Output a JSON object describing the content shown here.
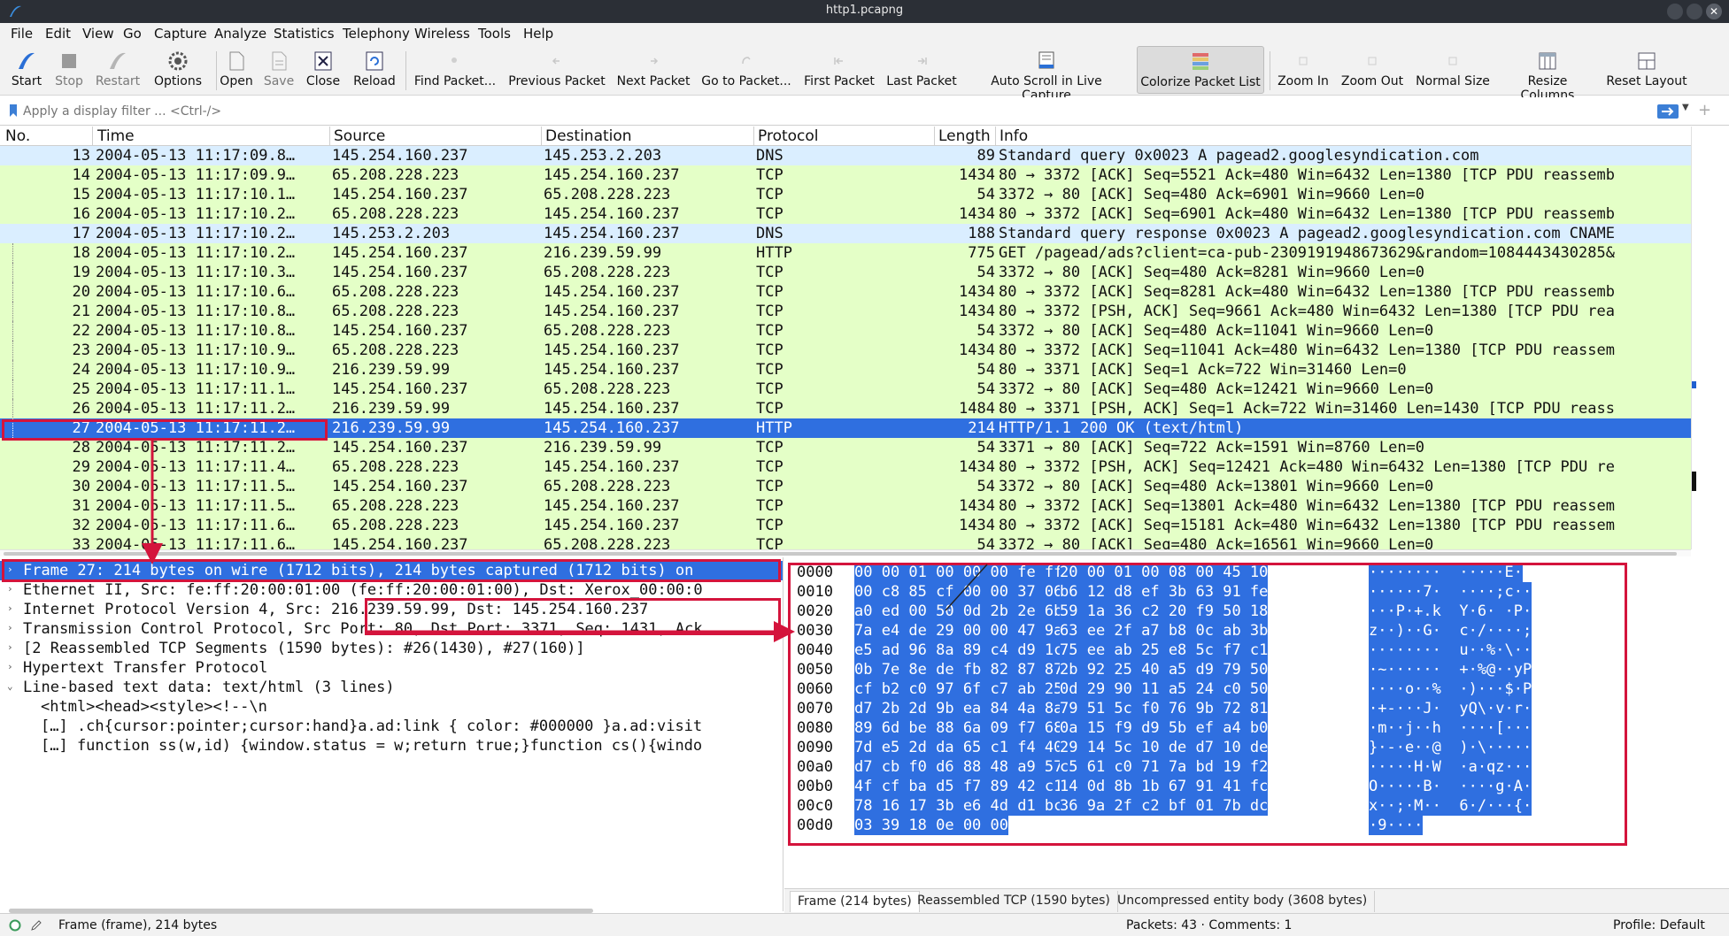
{
  "window": {
    "title": "http1.pcapng"
  },
  "menu": [
    "File",
    "Edit",
    "View",
    "Go",
    "Capture",
    "Analyze",
    "Statistics",
    "Telephony",
    "Wireless",
    "Tools",
    "Help"
  ],
  "toolbar": {
    "start": "Start",
    "stop": "Stop",
    "restart": "Restart",
    "options": "Options",
    "open": "Open",
    "save": "Save",
    "close": "Close",
    "reload": "Reload",
    "find_packet": "Find Packet...",
    "previous_packet": "Previous Packet",
    "next_packet": "Next Packet",
    "go_to_packet": "Go to Packet...",
    "first_packet": "First Packet",
    "last_packet": "Last Packet",
    "auto_scroll": "Auto Scroll in Live Capture",
    "colorize": "Colorize Packet List",
    "zoom_in": "Zoom In",
    "zoom_out": "Zoom Out",
    "normal_size": "Normal Size",
    "resize_columns": "Resize Columns",
    "reset_layout": "Reset Layout"
  },
  "filter": {
    "placeholder": "Apply a display filter ... <Ctrl-/>"
  },
  "packet_list": {
    "columns": [
      "No.",
      "Time",
      "Source",
      "Destination",
      "Protocol",
      "Length",
      "Info"
    ],
    "rows": [
      {
        "no": "13",
        "time": "2004-05-13 11:17:09.8…",
        "src": "145.254.160.237",
        "dst": "145.253.2.203",
        "proto": "DNS",
        "len": "89",
        "info": "Standard query 0x0023 A pagead2.googlesyndication.com",
        "kind": "dns"
      },
      {
        "no": "14",
        "time": "2004-05-13 11:17:09.9…",
        "src": "65.208.228.223",
        "dst": "145.254.160.237",
        "proto": "TCP",
        "len": "1434",
        "info": "80 → 3372 [ACK] Seq=5521 Ack=480 Win=6432 Len=1380 [TCP PDU reassemb",
        "kind": "tcp"
      },
      {
        "no": "15",
        "time": "2004-05-13 11:17:10.1…",
        "src": "145.254.160.237",
        "dst": "65.208.228.223",
        "proto": "TCP",
        "len": "54",
        "info": "3372 → 80 [ACK] Seq=480 Ack=6901 Win=9660 Len=0",
        "kind": "tcp"
      },
      {
        "no": "16",
        "time": "2004-05-13 11:17:10.2…",
        "src": "65.208.228.223",
        "dst": "145.254.160.237",
        "proto": "TCP",
        "len": "1434",
        "info": "80 → 3372 [ACK] Seq=6901 Ack=480 Win=6432 Len=1380 [TCP PDU reassemb",
        "kind": "tcp"
      },
      {
        "no": "17",
        "time": "2004-05-13 11:17:10.2…",
        "src": "145.253.2.203",
        "dst": "145.254.160.237",
        "proto": "DNS",
        "len": "188",
        "info": "Standard query response 0x0023 A pagead2.googlesyndication.com CNAME",
        "kind": "dns"
      },
      {
        "no": "18",
        "time": "2004-05-13 11:17:10.2…",
        "src": "145.254.160.237",
        "dst": "216.239.59.99",
        "proto": "HTTP",
        "len": "775",
        "info": "GET /pagead/ads?client=ca-pub-2309191948673629&random=1084443430285&",
        "kind": "http"
      },
      {
        "no": "19",
        "time": "2004-05-13 11:17:10.3…",
        "src": "145.254.160.237",
        "dst": "65.208.228.223",
        "proto": "TCP",
        "len": "54",
        "info": "3372 → 80 [ACK] Seq=480 Ack=8281 Win=9660 Len=0",
        "kind": "tcp"
      },
      {
        "no": "20",
        "time": "2004-05-13 11:17:10.6…",
        "src": "65.208.228.223",
        "dst": "145.254.160.237",
        "proto": "TCP",
        "len": "1434",
        "info": "80 → 3372 [ACK] Seq=8281 Ack=480 Win=6432 Len=1380 [TCP PDU reassemb",
        "kind": "tcp"
      },
      {
        "no": "21",
        "time": "2004-05-13 11:17:10.8…",
        "src": "65.208.228.223",
        "dst": "145.254.160.237",
        "proto": "TCP",
        "len": "1434",
        "info": "80 → 3372 [PSH, ACK] Seq=9661 Ack=480 Win=6432 Len=1380 [TCP PDU rea",
        "kind": "tcp"
      },
      {
        "no": "22",
        "time": "2004-05-13 11:17:10.8…",
        "src": "145.254.160.237",
        "dst": "65.208.228.223",
        "proto": "TCP",
        "len": "54",
        "info": "3372 → 80 [ACK] Seq=480 Ack=11041 Win=9660 Len=0",
        "kind": "tcp"
      },
      {
        "no": "23",
        "time": "2004-05-13 11:17:10.9…",
        "src": "65.208.228.223",
        "dst": "145.254.160.237",
        "proto": "TCP",
        "len": "1434",
        "info": "80 → 3372 [ACK] Seq=11041 Ack=480 Win=6432 Len=1380 [TCP PDU reassem",
        "kind": "tcp"
      },
      {
        "no": "24",
        "time": "2004-05-13 11:17:10.9…",
        "src": "216.239.59.99",
        "dst": "145.254.160.237",
        "proto": "TCP",
        "len": "54",
        "info": "80 → 3371 [ACK] Seq=1 Ack=722 Win=31460 Len=0",
        "kind": "tcp"
      },
      {
        "no": "25",
        "time": "2004-05-13 11:17:11.1…",
        "src": "145.254.160.237",
        "dst": "65.208.228.223",
        "proto": "TCP",
        "len": "54",
        "info": "3372 → 80 [ACK] Seq=480 Ack=12421 Win=9660 Len=0",
        "kind": "tcp"
      },
      {
        "no": "26",
        "time": "2004-05-13 11:17:11.2…",
        "src": "216.239.59.99",
        "dst": "145.254.160.237",
        "proto": "TCP",
        "len": "1484",
        "info": "80 → 3371 [PSH, ACK] Seq=1 Ack=722 Win=31460 Len=1430 [TCP PDU reass",
        "kind": "tcp"
      },
      {
        "no": "27",
        "time": "2004-05-13 11:17:11.2…",
        "src": "216.239.59.99",
        "dst": "145.254.160.237",
        "proto": "HTTP",
        "len": "214",
        "info": "HTTP/1.1 200 OK  (text/html)",
        "kind": "selected"
      },
      {
        "no": "28",
        "time": "2004-05-13 11:17:11.2…",
        "src": "145.254.160.237",
        "dst": "216.239.59.99",
        "proto": "TCP",
        "len": "54",
        "info": "3371 → 80 [ACK] Seq=722 Ack=1591 Win=8760 Len=0",
        "kind": "tcp"
      },
      {
        "no": "29",
        "time": "2004-05-13 11:17:11.4…",
        "src": "65.208.228.223",
        "dst": "145.254.160.237",
        "proto": "TCP",
        "len": "1434",
        "info": "80 → 3372 [PSH, ACK] Seq=12421 Ack=480 Win=6432 Len=1380 [TCP PDU re",
        "kind": "tcp"
      },
      {
        "no": "30",
        "time": "2004-05-13 11:17:11.5…",
        "src": "145.254.160.237",
        "dst": "65.208.228.223",
        "proto": "TCP",
        "len": "54",
        "info": "3372 → 80 [ACK] Seq=480 Ack=13801 Win=9660 Len=0",
        "kind": "tcp"
      },
      {
        "no": "31",
        "time": "2004-05-13 11:17:11.5…",
        "src": "65.208.228.223",
        "dst": "145.254.160.237",
        "proto": "TCP",
        "len": "1434",
        "info": "80 → 3372 [ACK] Seq=13801 Ack=480 Win=6432 Len=1380 [TCP PDU reassem",
        "kind": "tcp"
      },
      {
        "no": "32",
        "time": "2004-05-13 11:17:11.6…",
        "src": "65.208.228.223",
        "dst": "145.254.160.237",
        "proto": "TCP",
        "len": "1434",
        "info": "80 → 3372 [ACK] Seq=15181 Ack=480 Win=6432 Len=1380 [TCP PDU reassem",
        "kind": "tcp"
      },
      {
        "no": "33",
        "time": "2004-05-13 11:17:11.6…",
        "src": "145.254.160.237",
        "dst": "65.208.228.223",
        "proto": "TCP",
        "len": "54",
        "info": "3372 → 80 [ACK] Seq=480 Ack=16561 Win=9660 Len=0",
        "kind": "tcp"
      }
    ]
  },
  "details": [
    {
      "text": "Frame 27: 214 bytes on wire (1712 bits), 214 bytes captured (1712 bits) on",
      "arrow": "›",
      "selected": true
    },
    {
      "text": "Ethernet II, Src: fe:ff:20:00:01:00 (fe:ff:20:00:01:00), Dst: Xerox_00:00:0",
      "arrow": "›"
    },
    {
      "text": "Internet Protocol Version 4, Src: 216.239.59.99, Dst: 145.254.160.237",
      "arrow": "›"
    },
    {
      "text": "Transmission Control Protocol, Src Port: 80, Dst Port: 3371, Seq: 1431, Ack",
      "arrow": "›"
    },
    {
      "text": "[2 Reassembled TCP Segments (1590 bytes): #26(1430), #27(160)]",
      "arrow": "›"
    },
    {
      "text": "Hypertext Transfer Protocol",
      "arrow": "›"
    },
    {
      "text": "Line-based text data: text/html (3 lines)",
      "arrow": "⌄"
    },
    {
      "text": "<html><head><style><!--\\n",
      "child": true
    },
    {
      "text": "[…] .ch{cursor:pointer;cursor:hand}a.ad:link { color: #000000 }a.ad:visit",
      "child": true
    },
    {
      "text": "[…] function ss(w,id) {window.status = w;return true;}function cs(){windo",
      "child": true
    }
  ],
  "bytes": [
    {
      "off": "0000",
      "h1": "00 00 01 00 00 00 fe ff",
      "h2": "20 00 01 00 08 00 45 10",
      "asc": "········  ·····E·"
    },
    {
      "off": "0010",
      "h1": "00 c8 85 cf 00 00 37 06",
      "h2": "b6 12 d8 ef 3b 63 91 fe",
      "asc": "······7·  ····;c··"
    },
    {
      "off": "0020",
      "h1": "a0 ed 00 50 0d 2b 2e 6b",
      "h2": "59 1a 36 c2 20 f9 50 18",
      "asc": "···P·+.k  Y·6· ·P·"
    },
    {
      "off": "0030",
      "h1": "7a e4 de 29 00 00 47 9a",
      "h2": "63 ee 2f a7 b8 0c ab 3b",
      "asc": "z··)··G·  c·/····;"
    },
    {
      "off": "0040",
      "h1": "e5 ad 96 8a 89 c4 d9 1c",
      "h2": "75 ee ab 25 e8 5c f7 c1",
      "asc": "········  u··%·\\··"
    },
    {
      "off": "0050",
      "h1": "0b 7e 8e de fb 82 87 87",
      "h2": "2b 92 25 40 a5 d9 79 50",
      "asc": "·~······  +·%@··yP"
    },
    {
      "off": "0060",
      "h1": "cf b2 c0 97 6f c7 ab 25",
      "h2": "0d 29 90 11 a5 24 c0 50",
      "asc": "····o··%  ·)···$·P"
    },
    {
      "off": "0070",
      "h1": "d7 2b 2d 9b ea 84 4a 8a",
      "h2": "79 51 5c f0 76 9b 72 81",
      "asc": "·+-···J·  yQ\\·v·r·"
    },
    {
      "off": "0080",
      "h1": "89 6d be 88 6a 09 f7 68",
      "h2": "0a 15 f9 d9 5b ef a4 b0",
      "asc": "·m··j··h  ····[···"
    },
    {
      "off": "0090",
      "h1": "7d e5 2d da 65 c1 f4 40",
      "h2": "29 14 5c 10 de d7 10 de",
      "asc": "}·-·e··@  )·\\·····"
    },
    {
      "off": "00a0",
      "h1": "d7 cb f0 d6 88 48 a9 57",
      "h2": "c5 61 c0 71 7a bd 19 f2",
      "asc": "·····H·W  ·a·qz···"
    },
    {
      "off": "00b0",
      "h1": "4f cf ba d5 f7 89 42 c1",
      "h2": "14 0d 8b 1b 67 91 41 fc",
      "asc": "O·····B·  ····g·A·"
    },
    {
      "off": "00c0",
      "h1": "78 16 17 3b e6 4d d1 bc",
      "h2": "36 9a 2f c2 bf 01 7b dc",
      "asc": "x··;·M··  6·/···{·"
    },
    {
      "off": "00d0",
      "h1": "03 39 18 0e 00 00",
      "h2": "",
      "asc": "·9····"
    }
  ],
  "byte_tabs": [
    "Frame (214 bytes)",
    "Reassembled TCP (1590 bytes)",
    "Uncompressed entity body (3608 bytes)"
  ],
  "status": {
    "left": "Frame (frame), 214 bytes",
    "middle": "Packets: 43 · Comments: 1",
    "right": "Profile: Default"
  },
  "colors": {
    "tcp_row": "#e4ffc7",
    "http_row": "#e4ffc7",
    "dns_row": "#daeeff",
    "selected_row": "#2f6fe0",
    "annotation": "#d4143c"
  }
}
